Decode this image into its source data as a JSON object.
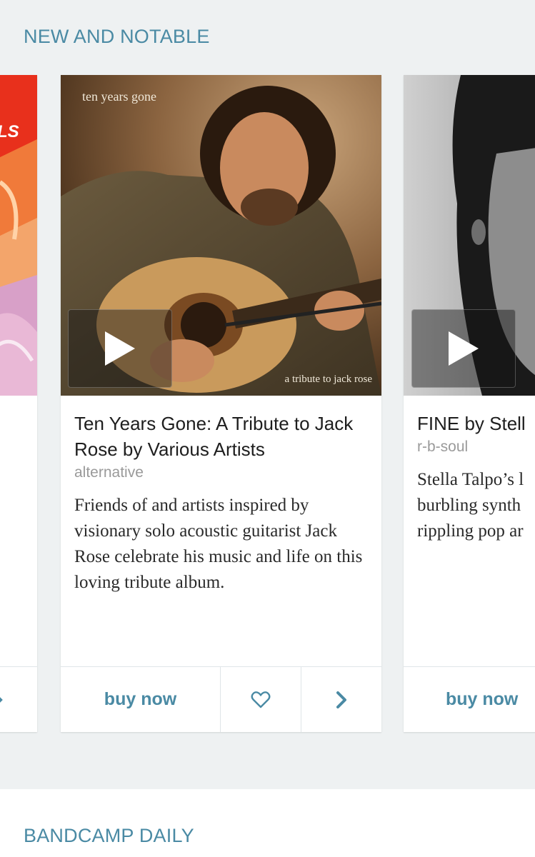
{
  "sections": {
    "new_and_notable": "NEW AND NOTABLE",
    "bandcamp_daily": "BANDCAMP DAILY"
  },
  "left_card": {
    "cover_letters": "LS",
    "cover_colors": [
      "#e8301c",
      "#f07a3a",
      "#d8a0c8"
    ]
  },
  "main_card": {
    "cover_text_top": "ten years gone",
    "cover_text_bottom": "a tribute to jack rose",
    "title": "Ten Years Gone: A Tribute to Jack Rose by Various Artists",
    "genre": "alternative",
    "blurb": "Friends of and artists inspired by visionary solo acoustic guitarist Jack Rose celebrate his music and life on this loving tribute album.",
    "buy_label": "buy now",
    "fav_icon": "heart-outline-icon",
    "more_icon": "chevron-right-icon"
  },
  "right_card": {
    "title": "FINE by Stell",
    "genre": "r-b-soul",
    "blurb": "Stella Talpo’s l burbling synth rippling pop ar",
    "buy_label": "buy now"
  },
  "colors": {
    "accent": "#4a8aa4",
    "page_bg": "#eef1f2"
  }
}
